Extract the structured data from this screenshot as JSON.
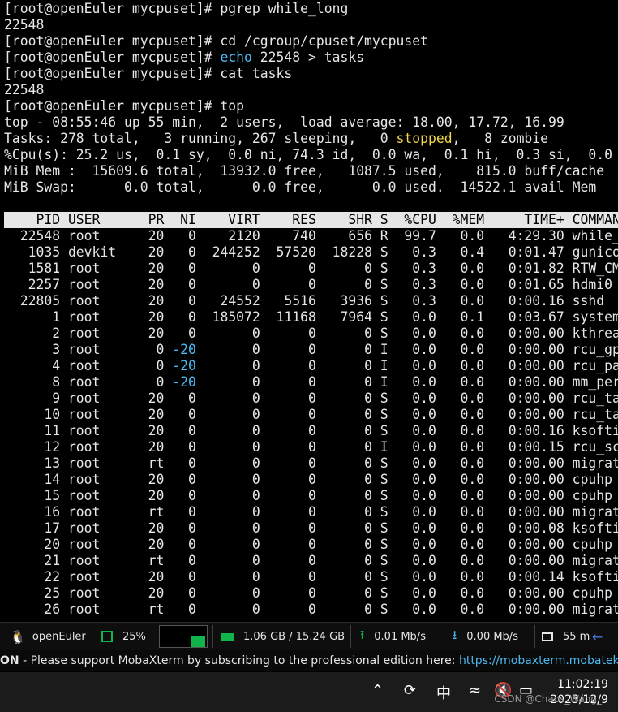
{
  "terminal": {
    "lines": [
      "[root@openEuler mycpuset]# pgrep while_long",
      "22548",
      "[root@openEuler mycpuset]# cd /cgroup/cpuset/mycpuset",
      {
        "prompt": "[root@openEuler mycpuset]# ",
        "cmd_word": "echo",
        "rest": " 22548 > tasks"
      },
      "[root@openEuler mycpuset]# cat tasks",
      "22548",
      "[root@openEuler mycpuset]# top",
      "top - 08:55:46 up 55 min,  2 users,  load average: 18.00, 17.72, 16.99",
      {
        "pre": "Tasks: 278 total,   3 running, 267 sleeping,   0 ",
        "stopped": "stopped",
        "post": ",   8 zombie"
      },
      "%Cpu(s): 25.2 us,  0.1 sy,  0.0 ni, 74.3 id,  0.0 wa,  0.1 hi,  0.3 si,  0.0",
      "MiB Mem :  15609.6 total,  13932.0 free,   1087.5 used,    815.0 buff/cache",
      "MiB Swap:      0.0 total,      0.0 free,      0.0 used.  14522.1 avail Mem"
    ],
    "table_header": "    PID USER      PR  NI    VIRT    RES    SHR S  %CPU  %MEM     TIME+ COMMAND",
    "processes": [
      {
        "pre": "  22548 root      20   0",
        "rest": "    2120    740    656 R  99.7   0.0   4:29.30 while_long"
      },
      {
        "pre": "   1035 devkit    20   0",
        "rest": "  244252  57520  18228 S   0.3   0.4   0:01.47 gunicorn"
      },
      {
        "pre": "   1581 root      20   0",
        "rest": "       0      0      0 S   0.3   0.0   0:01.82 RTW_CMD"
      },
      {
        "pre": "   2257 root      20   0",
        "rest": "       0      0      0 S   0.3   0.0   0:01.65 hdmi0"
      },
      {
        "pre": "  22805 root      20   0",
        "rest": "   24552   5516   3936 S   0.3   0.0   0:00.16 sshd"
      },
      {
        "pre": "      1 root      20   0",
        "rest": "  185072  11168   7964 S   0.0   0.1   0:03.67 systemd"
      },
      {
        "pre": "      2 root      20   0",
        "rest": "       0      0      0 S   0.0   0.0   0:00.00 kthreadd"
      },
      {
        "pre": "      3 root       0 ",
        "neg": "-20",
        "rest": "       0      0      0 I   0.0   0.0   0:00.00 rcu_gp"
      },
      {
        "pre": "      4 root       0 ",
        "neg": "-20",
        "rest": "       0      0      0 I   0.0   0.0   0:00.00 rcu_par_gp"
      },
      {
        "pre": "      8 root       0 ",
        "neg": "-20",
        "rest": "       0      0      0 I   0.0   0.0   0:00.00 mm_percpu_wq"
      },
      {
        "pre": "      9 root      20   0",
        "rest": "       0      0      0 S   0.0   0.0   0:00.00 rcu_tasks"
      },
      {
        "pre": "     10 root      20   0",
        "rest": "       0      0      0 S   0.0   0.0   0:00.00 rcu_tasks"
      },
      {
        "pre": "     11 root      20   0",
        "rest": "       0      0      0 S   0.0   0.0   0:00.16 ksoftirqd"
      },
      {
        "pre": "     12 root      20   0",
        "rest": "       0      0      0 I   0.0   0.0   0:00.15 rcu_sched"
      },
      {
        "pre": "     13 root      rt   0",
        "rest": "       0      0      0 S   0.0   0.0   0:00.00 migration"
      },
      {
        "pre": "     14 root      20   0",
        "rest": "       0      0      0 S   0.0   0.0   0:00.00 cpuhp"
      },
      {
        "pre": "     15 root      20   0",
        "rest": "       0      0      0 S   0.0   0.0   0:00.00 cpuhp"
      },
      {
        "pre": "     16 root      rt   0",
        "rest": "       0      0      0 S   0.0   0.0   0:00.00 migration"
      },
      {
        "pre": "     17 root      20   0",
        "rest": "       0      0      0 S   0.0   0.0   0:00.08 ksoftirqd"
      },
      {
        "pre": "     20 root      20   0",
        "rest": "       0      0      0 S   0.0   0.0   0:00.00 cpuhp"
      },
      {
        "pre": "     21 root      rt   0",
        "rest": "       0      0      0 S   0.0   0.0   0:00.00 migration"
      },
      {
        "pre": "     22 root      20   0",
        "rest": "       0      0      0 S   0.0   0.0   0:00.14 ksoftirqd"
      },
      {
        "pre": "     25 root      20   0",
        "rest": "       0      0      0 S   0.0   0.0   0:00.00 cpuhp"
      },
      {
        "pre": "     26 root      rt   0",
        "rest": "       0      0      0 S   0.0   0.0   0:00.00 migration"
      }
    ]
  },
  "status_bar": {
    "os_name": "openEuler",
    "os_icon": "penguin-icon",
    "cpu_percent": "25%",
    "cpu_icon": "chip-icon",
    "cpu_graph_level": 0.55,
    "memory": "1.06 GB / 15.24 GB",
    "memory_icon": "ram-icon",
    "upload": "0.01 Mb/s",
    "upload_icon": "upload-arrow-icon",
    "download": "0.00 Mb/s",
    "download_icon": "download-arrow-icon",
    "extra": "55 m",
    "extra_icon": "monitor-icon",
    "arrow_icon": "left-arrow-icon",
    "accent_green": "#11b34b",
    "accent_blue": "#4cb9f0"
  },
  "banner": {
    "prefix": "ON",
    "message": "  -  Please support MobaXterm by subscribing to the professional edition here:  ",
    "link": "https://mobaxterm.mobatek.net"
  },
  "windows_taskbar": {
    "ime": "中",
    "time": "11:02:19",
    "date": "2023/12/9",
    "watermark": "CSDN @Chaos_Wang_"
  }
}
